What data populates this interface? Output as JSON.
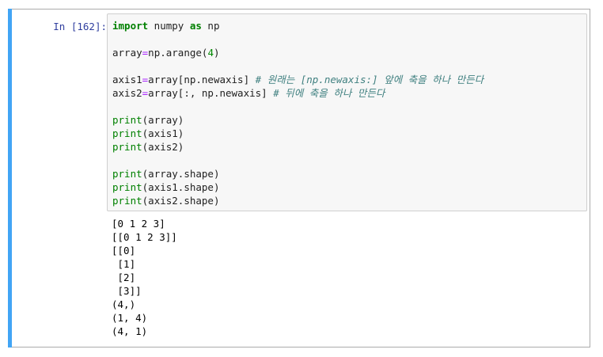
{
  "cell": {
    "prompt": "In [162]:",
    "accent_color": "#42a5f5"
  },
  "code": {
    "line1": {
      "kw1": "import",
      "mid": " numpy ",
      "kw2": "as",
      "end": " np"
    },
    "line3": {
      "lhs": "array",
      "eq": "=",
      "call": "np.arange(",
      "num": "4",
      "close": ")"
    },
    "line5": {
      "lhs": "axis1",
      "eq": "=",
      "rhs": "array[np.newaxis] ",
      "comment": "# 원래는 [np.newaxis:] 앞에 축을 하나 만든다"
    },
    "line6": {
      "lhs": "axis2",
      "eq": "=",
      "rhs": "array[:, np.newaxis] ",
      "comment": "# 뒤에 축을 하나 만든다"
    },
    "prints": [
      {
        "fn": "print",
        "args": "(array)"
      },
      {
        "fn": "print",
        "args": "(axis1)"
      },
      {
        "fn": "print",
        "args": "(axis2)"
      }
    ],
    "shape_prints": [
      {
        "fn": "print",
        "args": "(array.shape)"
      },
      {
        "fn": "print",
        "args": "(axis1.shape)"
      },
      {
        "fn": "print",
        "args": "(axis2.shape)"
      }
    ]
  },
  "output": {
    "lines": [
      "[0 1 2 3]",
      "[[0 1 2 3]]",
      "[[0]",
      " [1]",
      " [2]",
      " [3]]",
      "(4,)",
      "(1, 4)",
      "(4, 1)"
    ]
  }
}
